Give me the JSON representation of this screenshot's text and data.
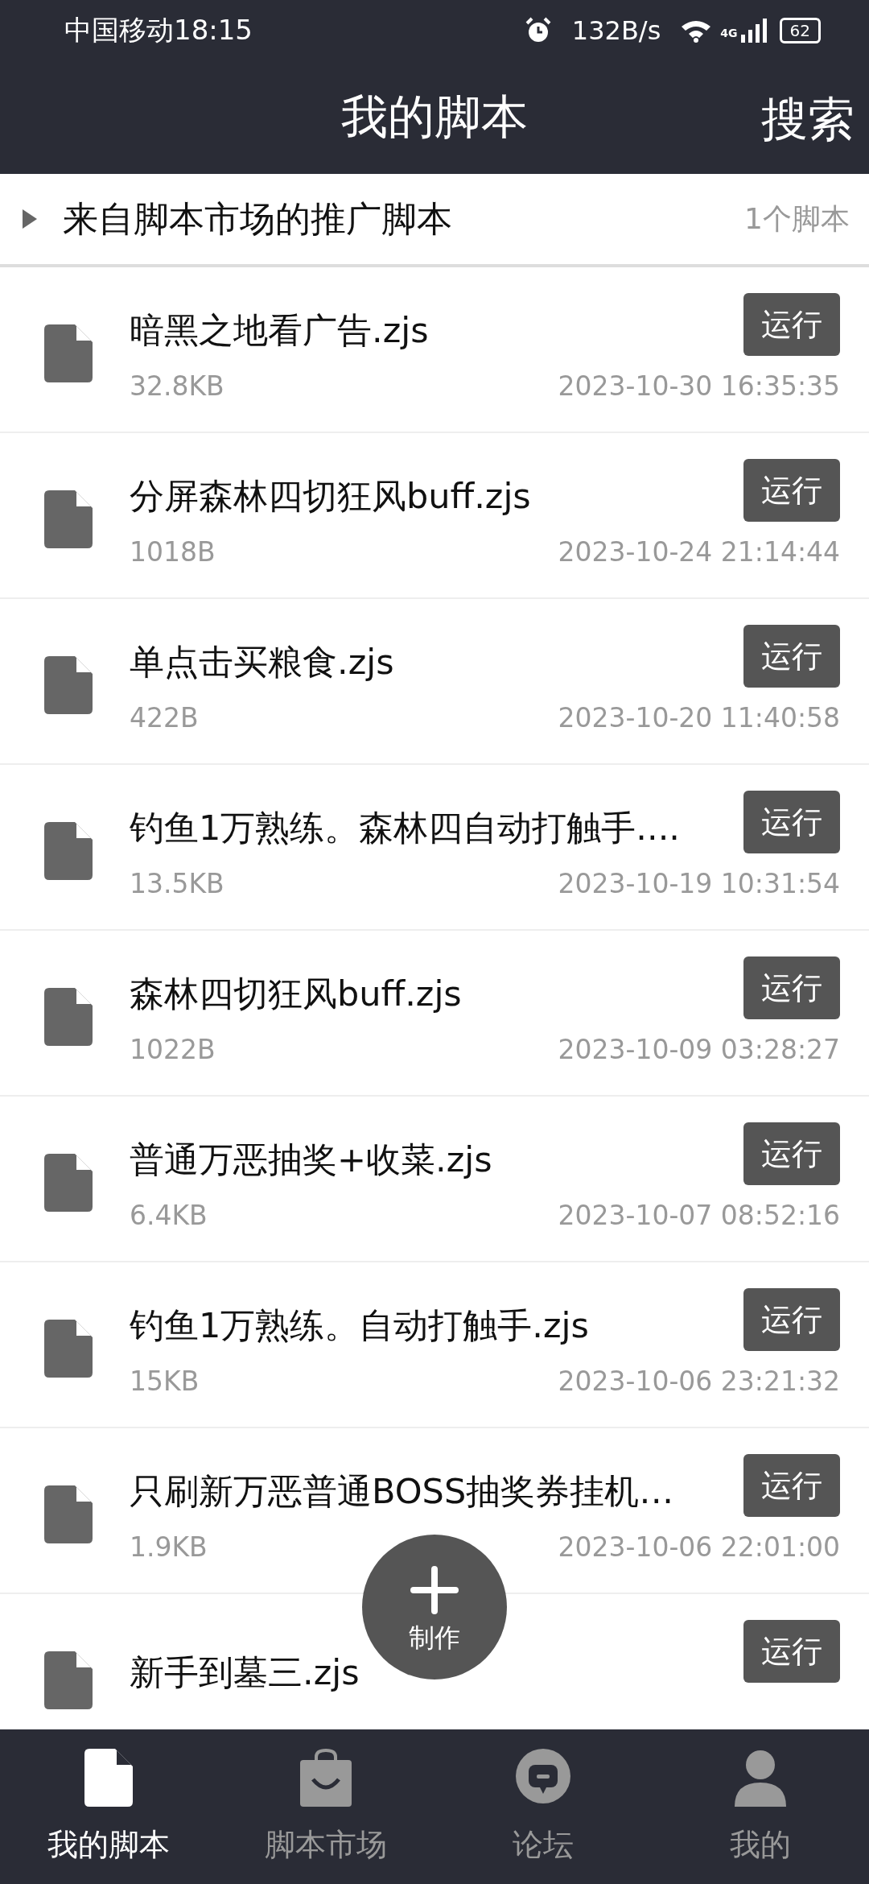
{
  "status_bar": {
    "carrier": "中国移动",
    "time": "18:15",
    "speed": "132B/s",
    "network_type": "4G",
    "battery": "62"
  },
  "header": {
    "title": "我的脚本",
    "action": "搜索"
  },
  "group": {
    "title": "来自脚本市场的推广脚本",
    "count": "1个脚本",
    "expanded": false
  },
  "scripts": [
    {
      "name": "暗黑之地看广告.zjs",
      "size": "32.8KB",
      "date": "2023-10-30 16:35:35",
      "button": "运行"
    },
    {
      "name": "分屏森林四切狂风buff.zjs",
      "size": "1018B",
      "date": "2023-10-24 21:14:44",
      "button": "运行"
    },
    {
      "name": "单点击买粮食.zjs",
      "size": "422B",
      "date": "2023-10-20 11:40:58",
      "button": "运行"
    },
    {
      "name": "钓鱼1万熟练。森林四自动打触手....",
      "size": "13.5KB",
      "date": "2023-10-19 10:31:54",
      "button": "运行"
    },
    {
      "name": "森林四切狂风buff.zjs",
      "size": "1022B",
      "date": "2023-10-09 03:28:27",
      "button": "运行"
    },
    {
      "name": "普通万恶抽奖+收菜.zjs",
      "size": "6.4KB",
      "date": "2023-10-07 08:52:16",
      "button": "运行"
    },
    {
      "name": "钓鱼1万熟练。自动打触手.zjs",
      "size": "15KB",
      "date": "2023-10-06 23:21:32",
      "button": "运行"
    },
    {
      "name": "只刷新万恶普通BOSS抽奖券挂机…",
      "size": "1.9KB",
      "date": "2023-10-06 22:01:00",
      "button": "运行"
    },
    {
      "name": "新手到墓三.zjs",
      "button": "运行"
    }
  ],
  "fab": {
    "label": "制作"
  },
  "nav": [
    {
      "kind": "file",
      "label": "我的脚本",
      "selected": true
    },
    {
      "kind": "bag",
      "label": "脚本市场",
      "selected": false
    },
    {
      "kind": "chat",
      "label": "论坛",
      "selected": false
    },
    {
      "kind": "person",
      "label": "我的",
      "selected": false
    }
  ]
}
